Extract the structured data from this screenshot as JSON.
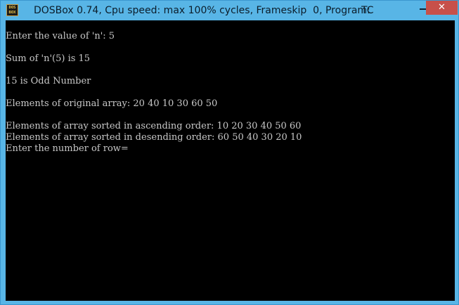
{
  "window": {
    "title": "DOSBox 0.74, Cpu speed: max 100% cycles, Frameskip  0, Program:",
    "program": "TC",
    "icon_line1": "DOS",
    "icon_line2": "BOX",
    "minimize_icon": "minimize-icon",
    "close_icon": "close-icon",
    "close_symbol": "✕",
    "close_color": "#c7504a"
  },
  "console": {
    "background": "#000000",
    "foreground": "#c8c8c8",
    "lines": [
      "Enter the value of 'n': 5",
      "Sum of 'n'(5) is 15",
      "15 is Odd Number",
      "Elements of original array: 20 40 10 30 60 50",
      "Elements of array sorted in ascending order: 10 20 30 40 50 60",
      "Elements of array sorted in desending order: 60 50 40 30 20 10",
      "Enter the number of row="
    ]
  }
}
